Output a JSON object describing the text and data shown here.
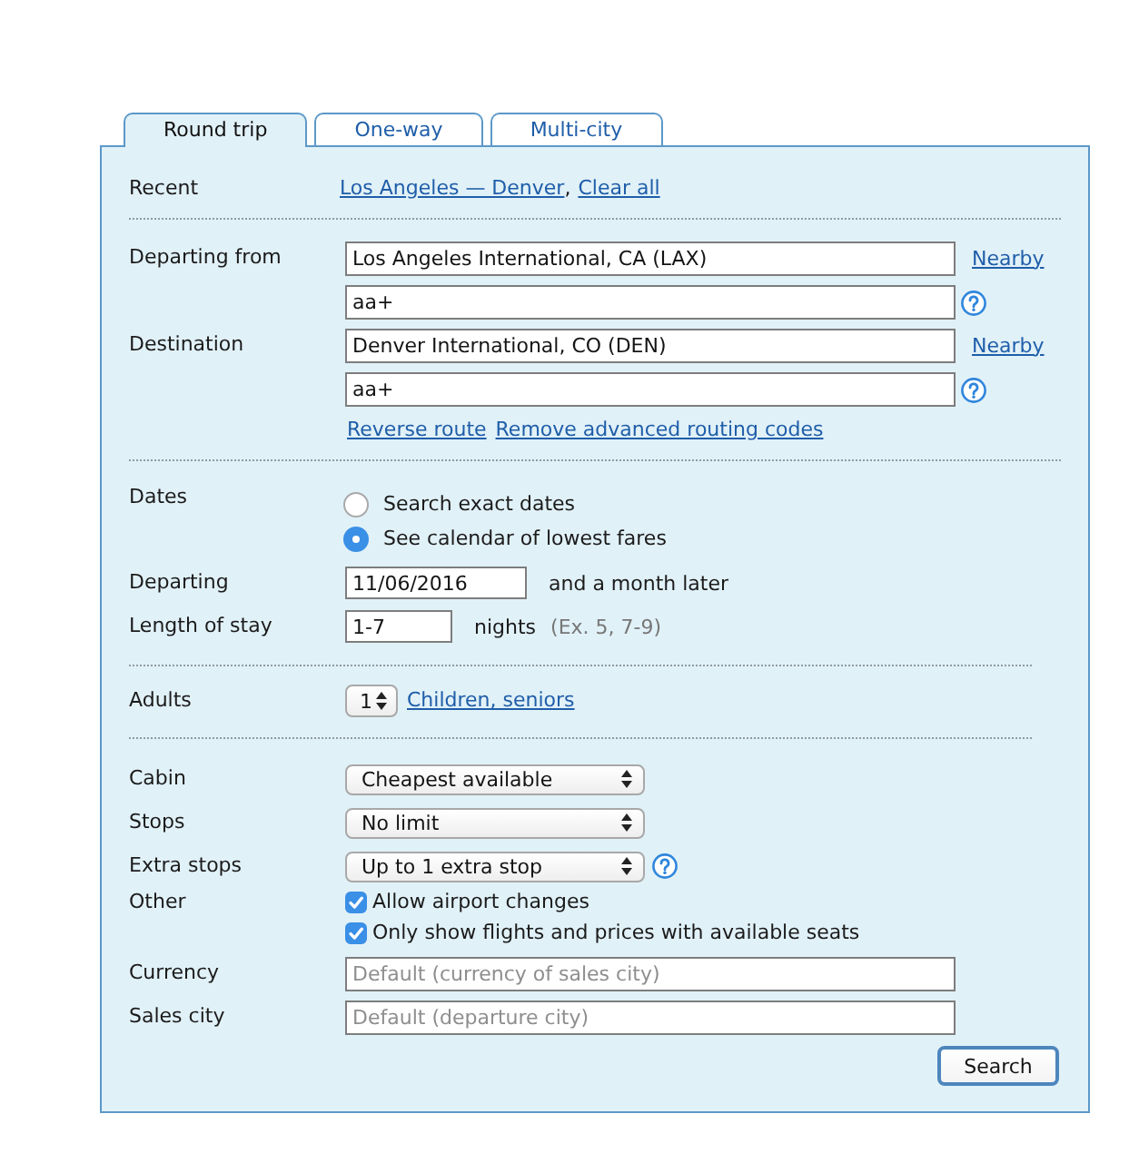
{
  "tabs": [
    {
      "label": "Round trip",
      "selected": true
    },
    {
      "label": "One-way",
      "selected": false
    },
    {
      "label": "Multi-city",
      "selected": false
    }
  ],
  "recent": {
    "label": "Recent",
    "route_link": "Los Angeles — Denver",
    "separator": ",",
    "clear_link": "Clear all"
  },
  "route": {
    "legs": [
      {
        "label": "Departing from",
        "value": "Los Angeles International, CA (LAX)",
        "nearby": "Nearby",
        "codes": "aa+"
      },
      {
        "label": "Destination",
        "value": "Denver International, CO (DEN)",
        "nearby": "Nearby",
        "codes": "aa+"
      }
    ],
    "links": [
      "Reverse route",
      "Remove advanced routing codes"
    ]
  },
  "dates": {
    "label": "Dates",
    "options": [
      {
        "label": "Search exact dates",
        "selected": false
      },
      {
        "label": "See calendar of lowest fares",
        "selected": true
      }
    ],
    "departing": {
      "label": "Departing",
      "value": "11/06/2016",
      "note": "and a month later"
    },
    "stay": {
      "label": "Length of stay",
      "value": "1-7",
      "unit": "nights",
      "hint": "(Ex. 5, 7-9)"
    }
  },
  "adults": {
    "label": "Adults",
    "value": "1",
    "link": "Children, seniors"
  },
  "options": [
    {
      "kind": "select",
      "label": "Cabin",
      "value": "Cheapest available",
      "help": false
    },
    {
      "kind": "select",
      "label": "Stops",
      "value": "No limit",
      "help": false
    },
    {
      "kind": "select",
      "label": "Extra stops",
      "value": "Up to 1 extra stop",
      "help": true
    },
    {
      "kind": "checks",
      "label": "Other",
      "items": [
        {
          "label": "Allow airport changes",
          "checked": true
        },
        {
          "label": "Only show flights and prices with available seats",
          "checked": true
        }
      ]
    },
    {
      "kind": "text",
      "label": "Currency",
      "placeholder": "Default (currency of sales city)"
    },
    {
      "kind": "text",
      "label": "Sales city",
      "placeholder": "Default (departure city)"
    }
  ],
  "search_button": "Search"
}
